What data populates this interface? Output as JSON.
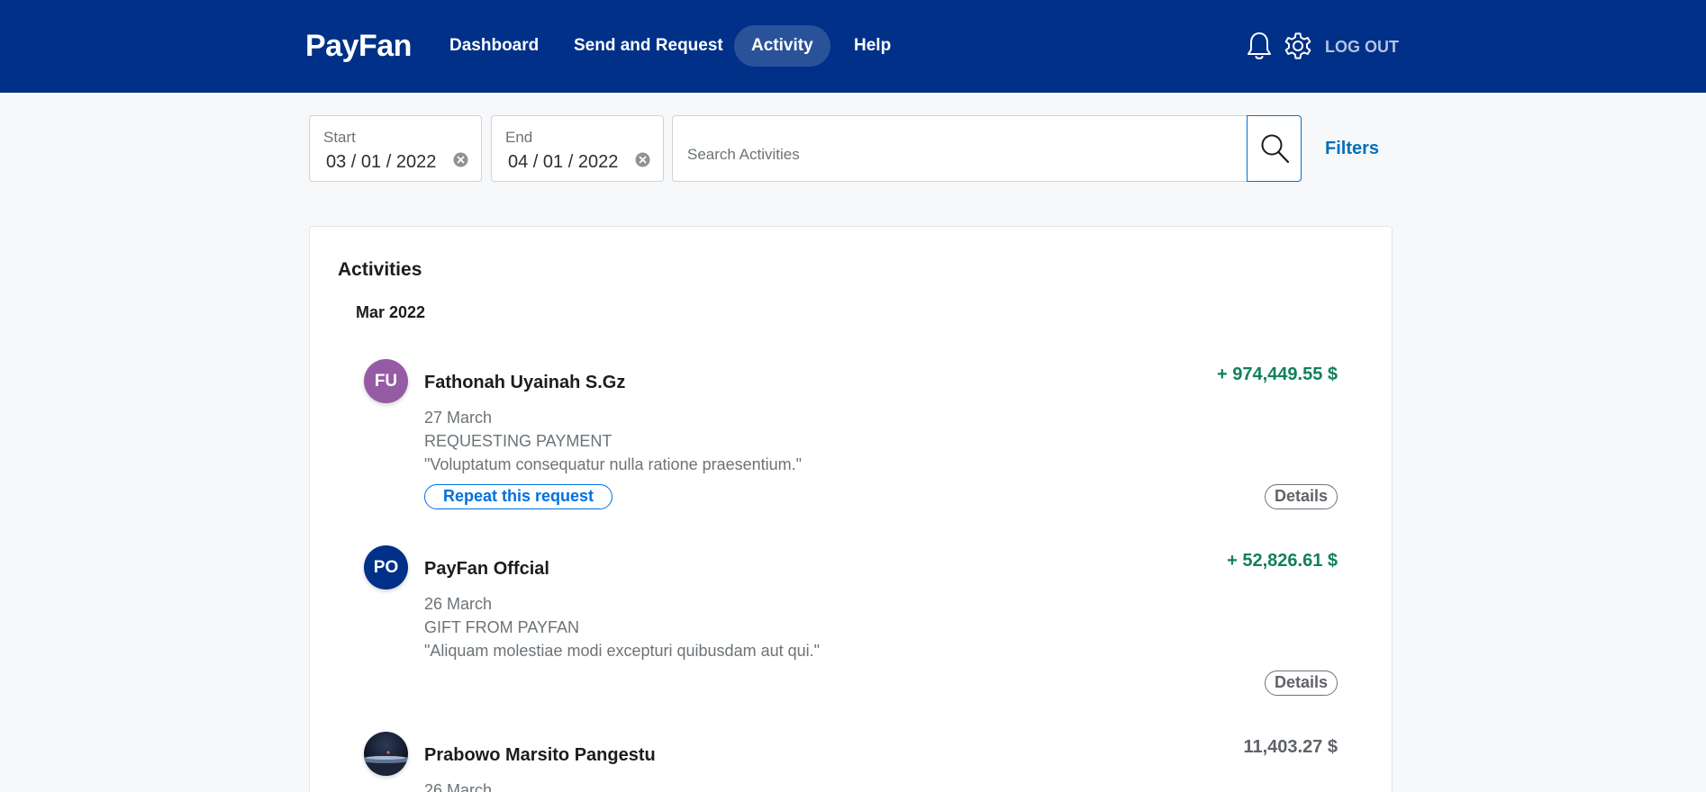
{
  "header": {
    "brand": "PayFan",
    "nav": [
      {
        "label": "Dashboard",
        "active": false
      },
      {
        "label": "Send and Request",
        "active": false
      },
      {
        "label": "Activity",
        "active": true
      },
      {
        "label": "Help",
        "active": false
      }
    ],
    "icons": [
      "bell-icon",
      "gear-icon"
    ],
    "logout_label": "LOG OUT"
  },
  "filters": {
    "start": {
      "label": "Start",
      "value": "03 / 01 / 2022"
    },
    "end": {
      "label": "End",
      "value": "04 / 01 / 2022"
    },
    "search": {
      "placeholder": "Search Activities",
      "value": ""
    },
    "filters_label": "Filters"
  },
  "activities": {
    "title": "Activities",
    "month": "Mar 2022",
    "items": [
      {
        "initials": "FU",
        "avatar_color": "#955ba5",
        "name": "Fathonah Uyainah S.Gz",
        "date": "27 March",
        "type": "REQUESTING PAYMENT",
        "note": "\"Voluptatum consequatur nulla ratione praesentium.\"",
        "amount": "+ 974,449.55 $",
        "repeat_label": "Repeat this request",
        "details_label": "Details"
      },
      {
        "initials": "PO",
        "avatar_color": "#003087",
        "name": "PayFan Offcial",
        "date": "26 March",
        "type": "GIFT FROM PAYFAN",
        "note": "\"Aliquam molestiae modi excepturi quibusdam aut qui.\"",
        "amount": "+ 52,826.61 $",
        "details_label": "Details"
      },
      {
        "initials": "",
        "avatar_color": "#1b2233",
        "name": "Prabowo Marsito Pangestu",
        "date": "26 March",
        "amount": "11,403.27 $"
      }
    ]
  },
  "colors": {
    "header_bg": "#003087",
    "positive_amount": "#12805c",
    "link_blue": "#0070ba"
  }
}
